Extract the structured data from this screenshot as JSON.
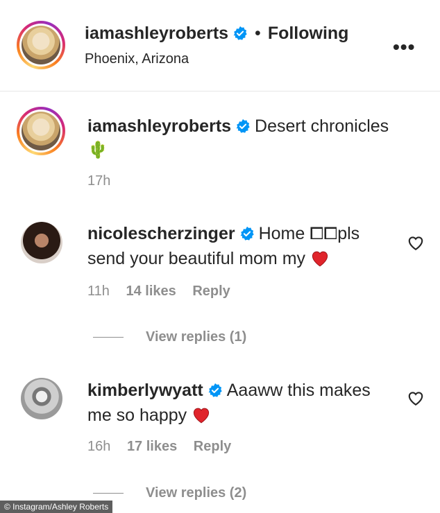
{
  "header": {
    "username": "iamashleyroberts",
    "separator": "•",
    "follow_status": "Following",
    "location": "Phoenix, Arizona",
    "more_label": "•••"
  },
  "caption": {
    "username": "iamashleyroberts",
    "text": "Desert chronicles",
    "emoji": "🌵",
    "time": "17h"
  },
  "comments": [
    {
      "username": "nicolescherzinger",
      "text_line1": "Home ⧠⧠pls",
      "text_line2": "send your beautiful mom my",
      "time": "11h",
      "likes": "14 likes",
      "reply": "Reply",
      "view_replies": "View replies (1)"
    },
    {
      "username": "kimberlywyatt",
      "text_line1": "Aaaww this makes",
      "text_line2": "me so happy",
      "time": "16h",
      "likes": "17 likes",
      "reply": "Reply",
      "view_replies": "View replies (2)"
    }
  ],
  "credit": "© Instagram/Ashley Roberts",
  "colors": {
    "verified": "#0095f6",
    "heart": "#ed4956",
    "muted": "#8e8e8e"
  }
}
